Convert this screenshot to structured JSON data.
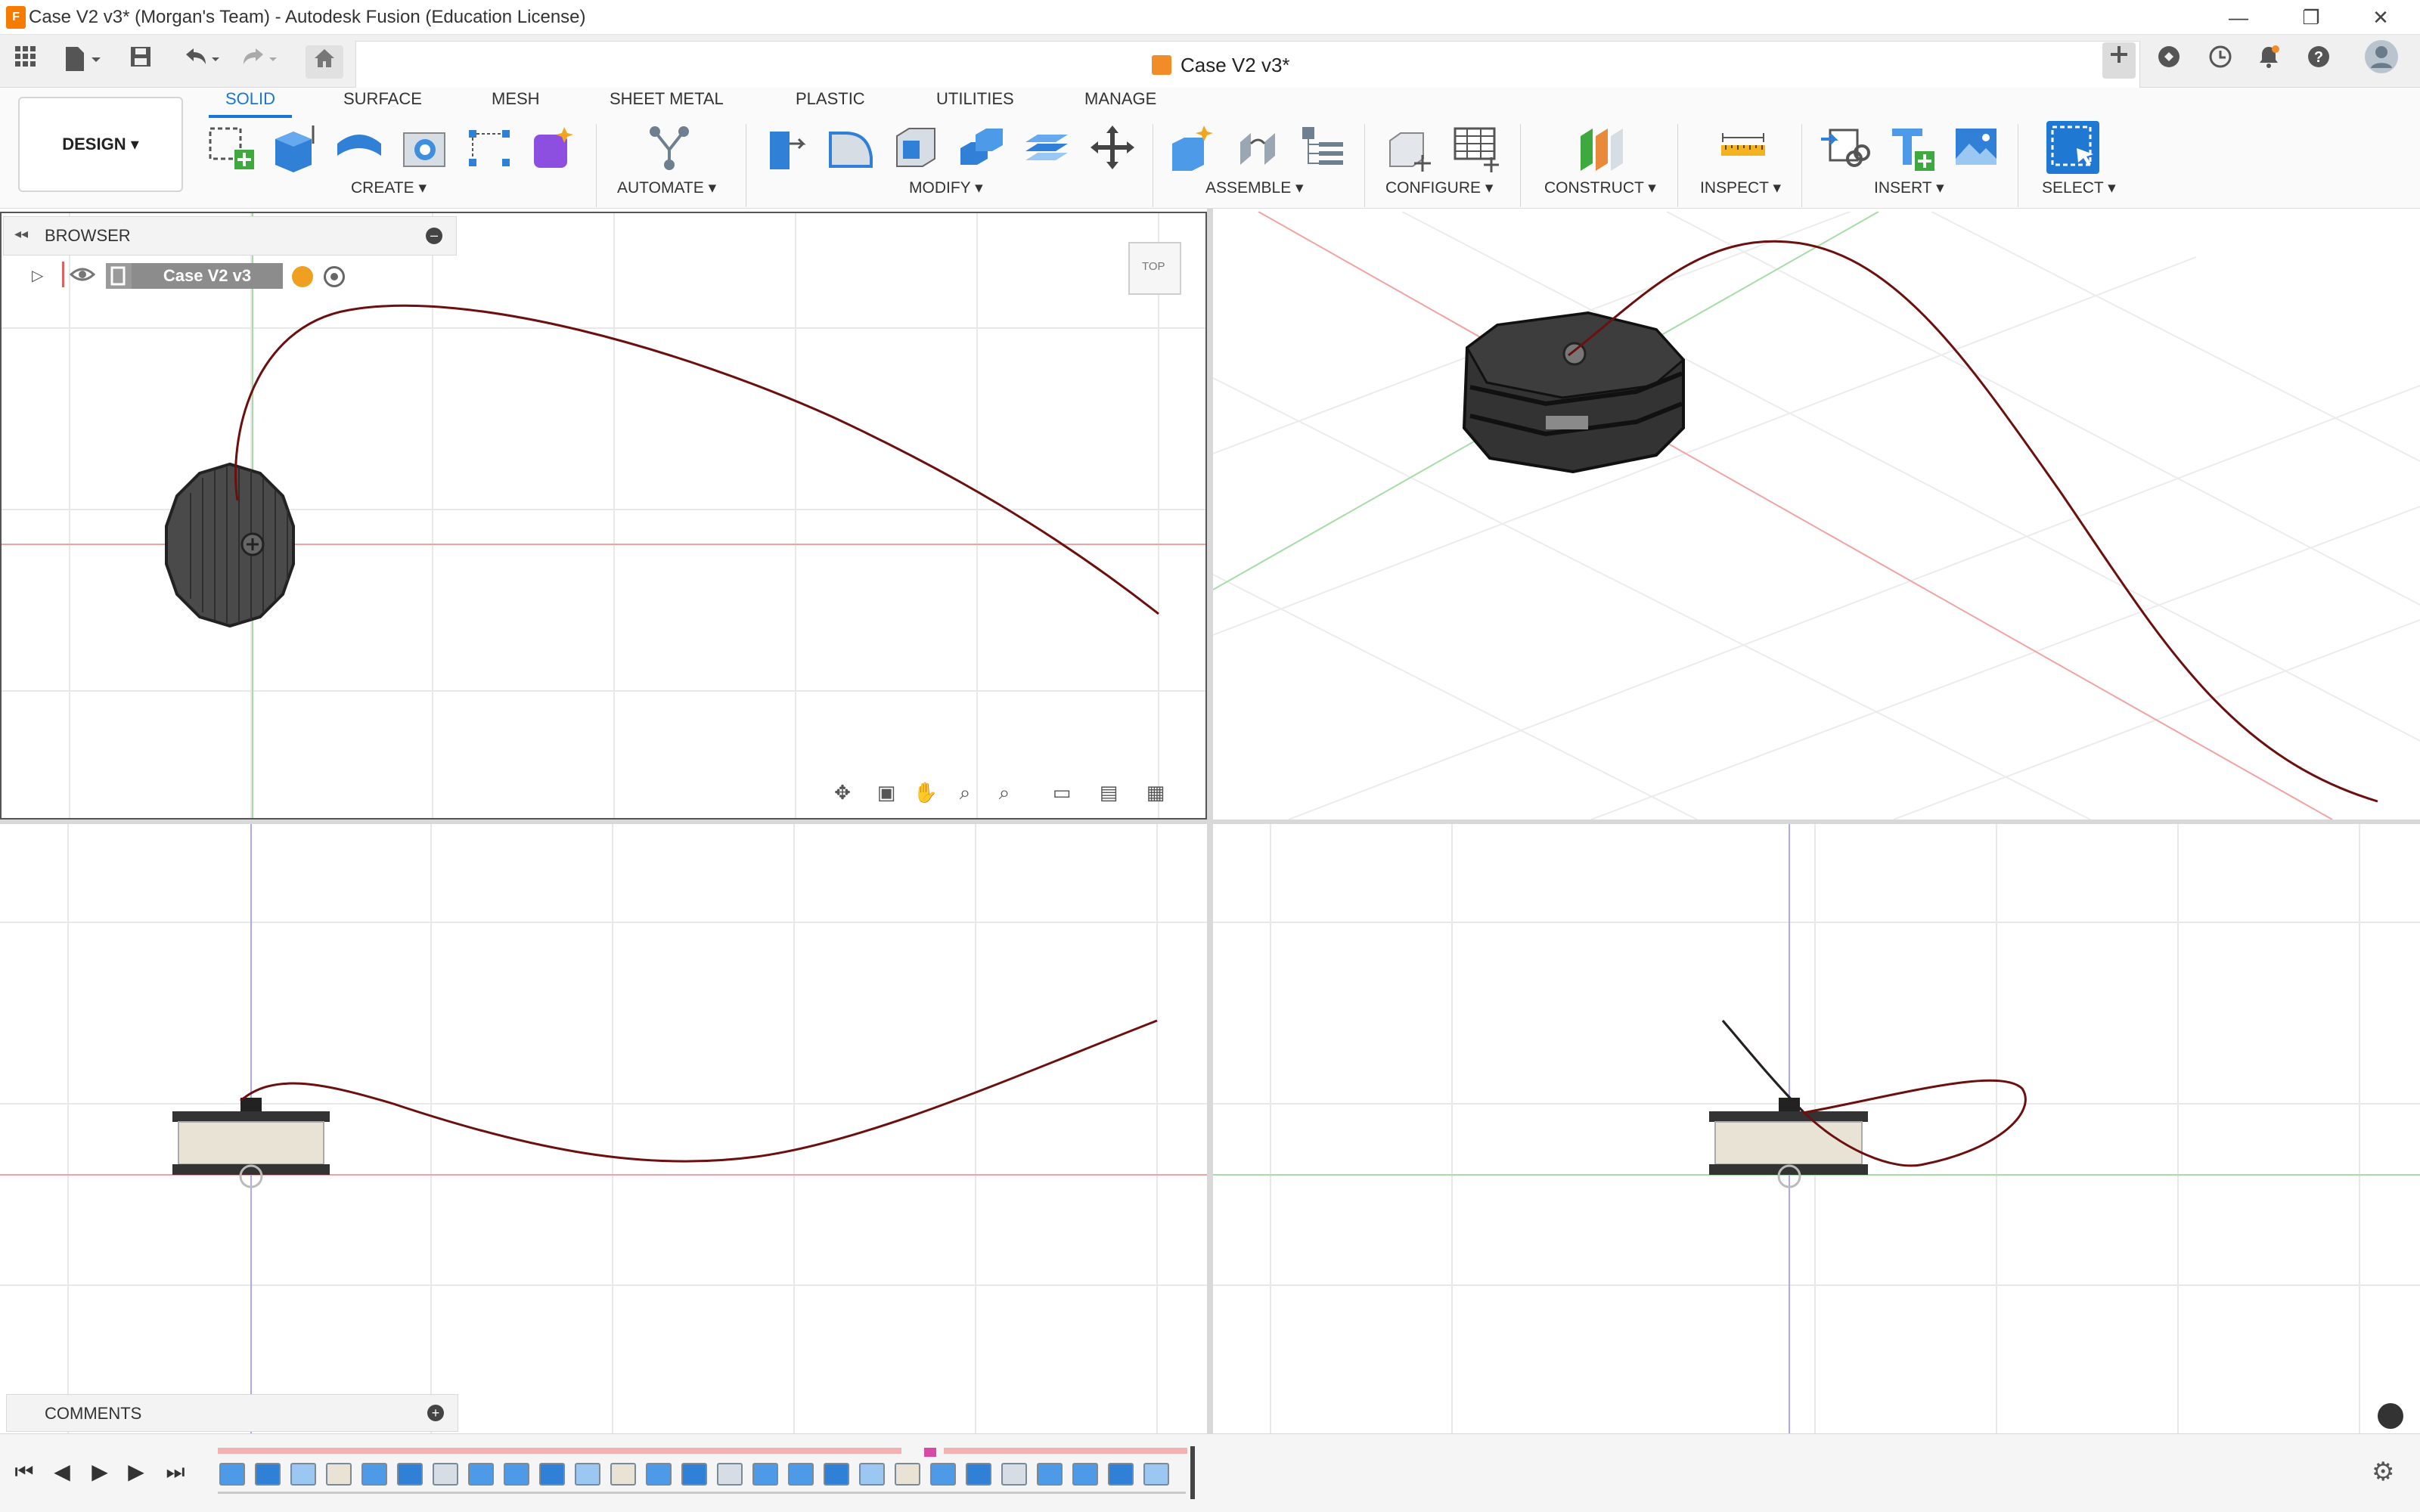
{
  "window": {
    "title": "Case V2 v3* (Morgan's Team) - Autodesk Fusion (Education License)",
    "controls": {
      "minimize": "—",
      "restore": "❐",
      "close": "✕"
    }
  },
  "document_tab": {
    "label": "Case V2 v3*",
    "close": "✕"
  },
  "toolbar": {
    "design_label": "DESIGN ▾",
    "tabs": [
      "SOLID",
      "SURFACE",
      "MESH",
      "SHEET METAL",
      "PLASTIC",
      "UTILITIES",
      "MANAGE"
    ],
    "active_tab": "SOLID",
    "groups": {
      "create": "CREATE ▾",
      "automate": "AUTOMATE ▾",
      "modify": "MODIFY ▾",
      "assemble": "ASSEMBLE ▾",
      "configure": "CONFIGURE ▾",
      "construct": "CONSTRUCT ▾",
      "inspect": "INSPECT ▾",
      "insert": "INSERT ▾",
      "select": "SELECT ▾"
    }
  },
  "browser": {
    "title": "BROWSER",
    "component": "Case V2 v3"
  },
  "comments": {
    "title": "COMMENTS"
  },
  "viewcube": {
    "face": "TOP"
  },
  "colors": {
    "accent": "#1976d2",
    "curve": "#6b0f0f",
    "x_axis": "#f0a0a0",
    "y_axis": "#9fd89f",
    "z_axis": "#a8a8ff",
    "model": "#3b3b3b"
  },
  "icons": {
    "apps": "grid-icon",
    "file": "file-icon",
    "save": "save-icon",
    "undo": "undo-icon",
    "redo": "redo-icon",
    "home": "home-icon",
    "new_tab": "plus-icon",
    "extensions": "extension-icon",
    "job_status": "clock-icon",
    "notifications": "bell-icon",
    "help": "help-icon",
    "profile": "avatar-icon",
    "timeline_settings": "gear-icon"
  }
}
